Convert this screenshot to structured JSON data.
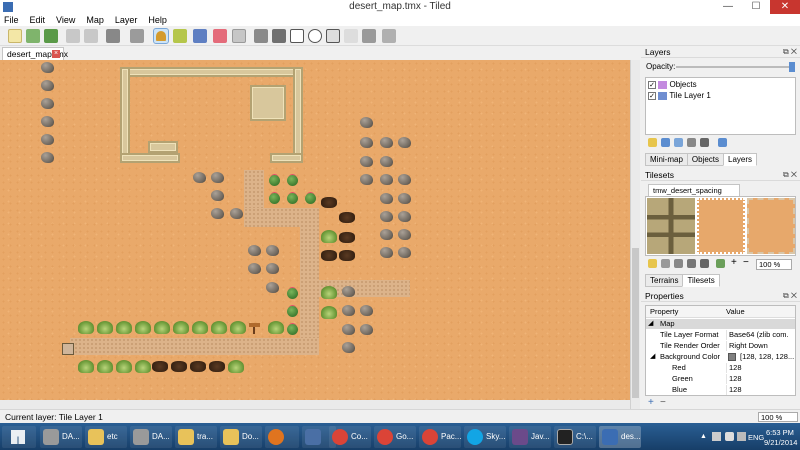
{
  "window": {
    "title": "desert_map.tmx - Tiled",
    "min": "—",
    "max": "☐",
    "close": "✕"
  },
  "menu": [
    "File",
    "Edit",
    "View",
    "Map",
    "Layer",
    "Help"
  ],
  "doc_tab": {
    "label": "desert_map.tmx",
    "close": "×"
  },
  "layers_panel": {
    "title": "Layers",
    "opacity_label": "Opacity:",
    "layers": [
      {
        "name": "Objects",
        "checked": true,
        "icon": "objects-layer-icon"
      },
      {
        "name": "Tile Layer 1",
        "checked": true,
        "icon": "tile-layer-icon"
      }
    ],
    "tabs": [
      "Mini-map",
      "Objects",
      "Layers"
    ],
    "active_tab": "Layers"
  },
  "tilesets_panel": {
    "title": "Tilesets",
    "tileset_tab": "tmw_desert_spacing",
    "zoom": "100 %",
    "tabs": [
      "Terrains",
      "Tilesets"
    ],
    "active_tab": "Tilesets"
  },
  "properties_panel": {
    "title": "Properties",
    "col_property": "Property",
    "col_value": "Value",
    "rows": [
      {
        "key": "Map",
        "value": "",
        "group": true
      },
      {
        "key": "Tile Layer Format",
        "value": "Base64 (zlib com..."
      },
      {
        "key": "Tile Render Order",
        "value": "Right Down"
      },
      {
        "key": "Background Color",
        "value": "[128, 128, 128...",
        "swatch": "#808080"
      },
      {
        "key": "Red",
        "value": "128",
        "indent": true
      },
      {
        "key": "Green",
        "value": "128",
        "indent": true
      },
      {
        "key": "Blue",
        "value": "128",
        "indent": true
      }
    ]
  },
  "status": {
    "current_layer": "Current layer: Tile Layer 1",
    "zoom": "100 %"
  },
  "taskbar": {
    "items": [
      {
        "label": "DA...",
        "color": "#9a9a9a"
      },
      {
        "label": "etc",
        "color": "#e8c25a"
      },
      {
        "label": "DA...",
        "color": "#9a9a9a"
      },
      {
        "label": "tra...",
        "color": "#e8c25a"
      },
      {
        "label": "Do...",
        "color": "#e8c25a"
      },
      {
        "label": "",
        "color": "#e0741f"
      },
      {
        "label": "",
        "color": "#4a6fa5"
      },
      {
        "label": "Co...",
        "color": "#db4437"
      },
      {
        "label": "Go...",
        "color": "#db4437"
      },
      {
        "label": "Pac...",
        "color": "#db4437"
      },
      {
        "label": "Sky...",
        "color": "#12a5e5"
      },
      {
        "label": "Jav...",
        "color": "#6b4a8a"
      },
      {
        "label": "C:\\...",
        "color": "#222222"
      },
      {
        "label": "des...",
        "color": "#3b6db3"
      }
    ],
    "lang": "ENG",
    "time": "6:53 PM",
    "date": "9/21/2014"
  }
}
